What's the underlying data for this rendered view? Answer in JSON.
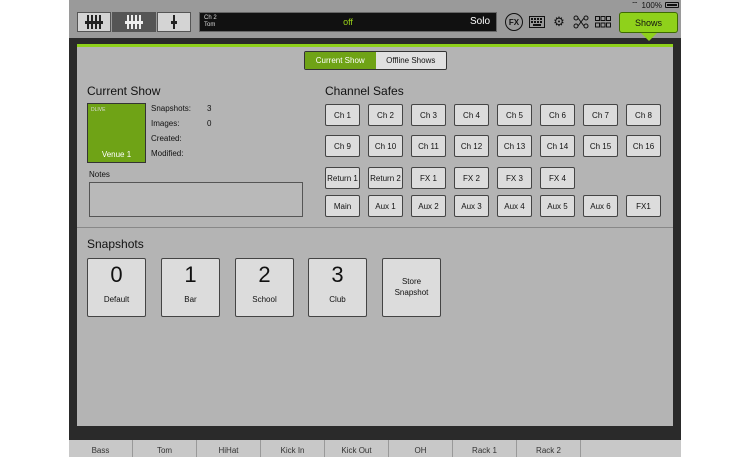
{
  "status": {
    "battery": "100%"
  },
  "topbar": {
    "display": {
      "channel_line1": "Ch 2",
      "channel_line2": "Tom",
      "state": "off",
      "solo": "Solo"
    },
    "fx_label": "FX",
    "shows_label": "Shows"
  },
  "tabs": [
    {
      "label": "Current Show",
      "active": true
    },
    {
      "label": "Offline Shows",
      "active": false
    }
  ],
  "current_show": {
    "title": "Current Show",
    "card_small": "DLIVE",
    "card_name": "Venue 1",
    "snapshots_label": "Snapshots:",
    "snapshots_value": "3",
    "images_label": "Images:",
    "images_value": "0",
    "created_label": "Created:",
    "modified_label": "Modified:",
    "notes_label": "Notes"
  },
  "channel_safes": {
    "title": "Channel Safes",
    "rows": [
      [
        "Ch 1",
        "Ch 2",
        "Ch 3",
        "Ch 4",
        "Ch 5",
        "Ch 6",
        "Ch 7",
        "Ch 8"
      ],
      [
        "Ch 9",
        "Ch 10",
        "Ch 11",
        "Ch 12",
        "Ch 13",
        "Ch 14",
        "Ch 15",
        "Ch 16"
      ],
      [
        "Return 1",
        "Return 2",
        "FX 1",
        "FX 2",
        "FX 3",
        "FX 4"
      ],
      [
        "Main",
        "Aux 1",
        "Aux 2",
        "Aux 3",
        "Aux 4",
        "Aux 5",
        "Aux 6",
        "FX1"
      ]
    ]
  },
  "snapshots": {
    "title": "Snapshots",
    "items": [
      {
        "num": "0",
        "name": "Default"
      },
      {
        "num": "1",
        "name": "Bar"
      },
      {
        "num": "2",
        "name": "School"
      },
      {
        "num": "3",
        "name": "Club"
      }
    ],
    "store_line1": "Store",
    "store_line2": "Snapshot"
  },
  "bottom_strip": [
    "Bass",
    "Tom",
    "HiHat",
    "Kick In",
    "Kick Out",
    "OH",
    "Rack 1",
    "Rack 2"
  ],
  "colors": {
    "accent": "#8fd11b",
    "active_tab": "#6fa316",
    "panel": "#b4b4b4"
  }
}
